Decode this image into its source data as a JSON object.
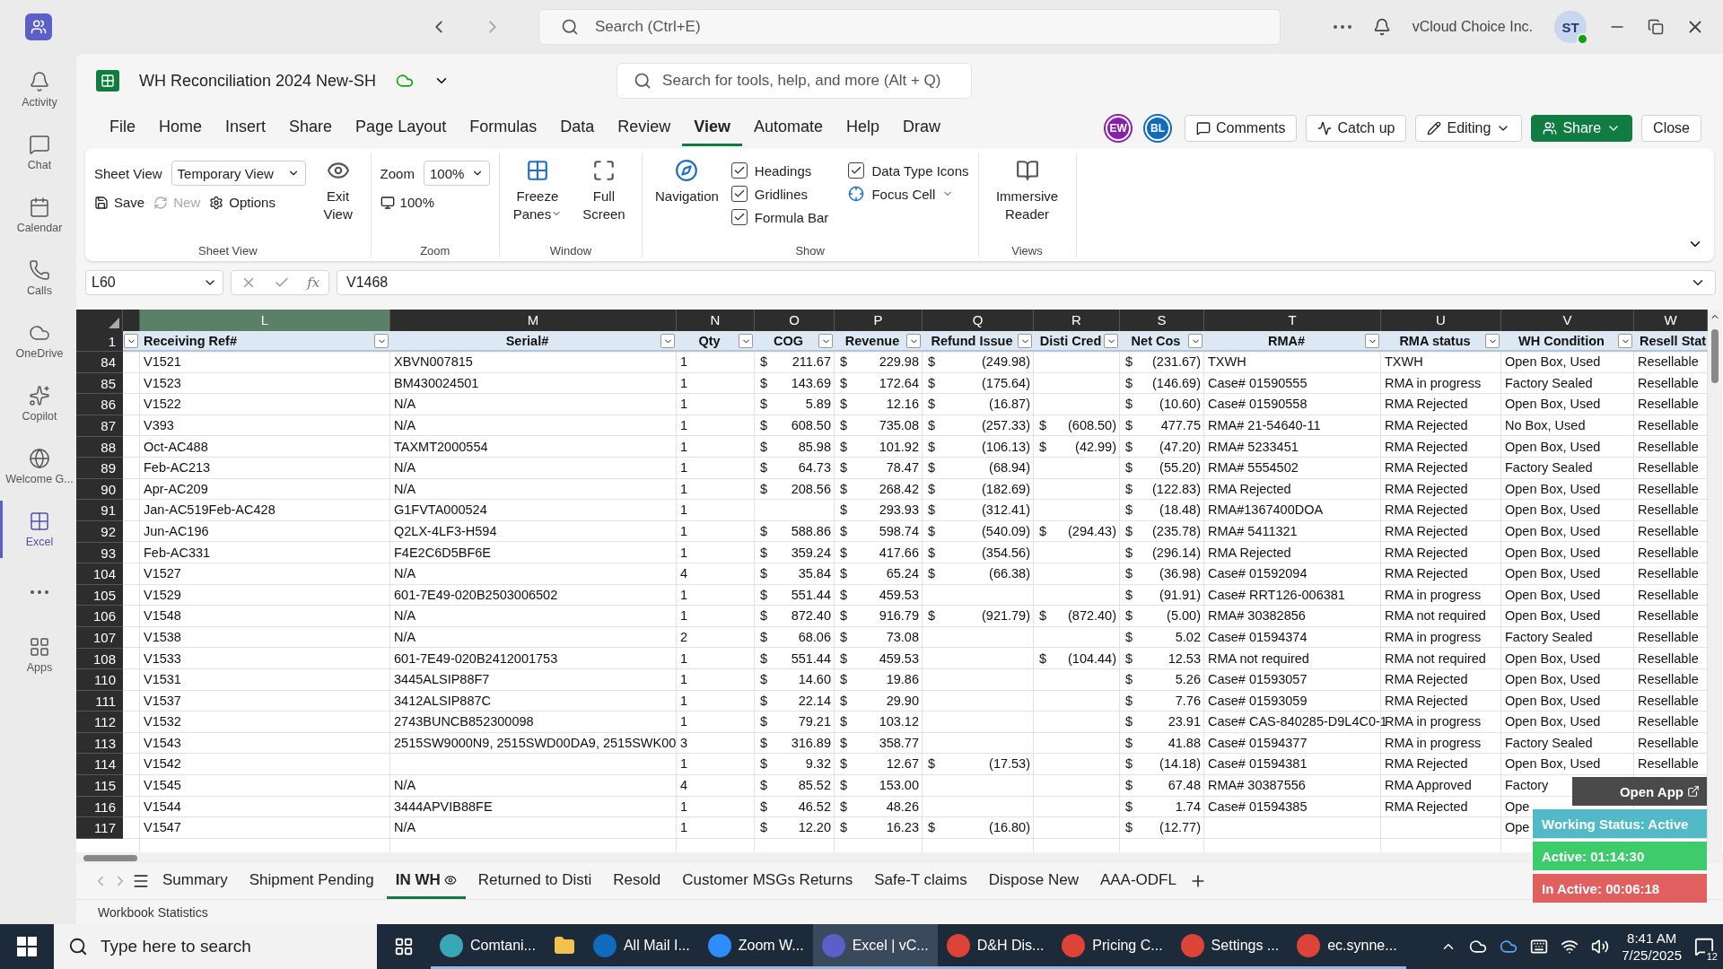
{
  "app_bar": {
    "search_placeholder": "Search (Ctrl+E)",
    "org": "vCloud Choice Inc.",
    "avatar": "ST"
  },
  "rail": [
    {
      "label": "Activity",
      "kind": "bell",
      "selected": false
    },
    {
      "label": "Chat",
      "kind": "chat",
      "selected": false
    },
    {
      "label": "Calendar",
      "kind": "calendar",
      "selected": false
    },
    {
      "label": "Calls",
      "kind": "calls",
      "selected": false
    },
    {
      "label": "OneDrive",
      "kind": "cloud",
      "selected": false
    },
    {
      "label": "Copilot",
      "kind": "copilot",
      "selected": false
    },
    {
      "label": "Welcome G...",
      "kind": "welcome",
      "selected": false
    },
    {
      "label": "Excel",
      "kind": "excel",
      "selected": true
    },
    {
      "kind": "more",
      "selected": false
    },
    {
      "label": "Apps",
      "kind": "apps",
      "selected": false
    }
  ],
  "workbook": {
    "title": "WH Reconciliation 2024 New-SH",
    "search_placeholder": "Search for tools, help, and more (Alt + Q)"
  },
  "menu": [
    {
      "label": "File",
      "selected": false
    },
    {
      "label": "Home",
      "selected": false
    },
    {
      "label": "Insert",
      "selected": false
    },
    {
      "label": "Share",
      "selected": false
    },
    {
      "label": "Page Layout",
      "selected": false
    },
    {
      "label": "Formulas",
      "selected": false
    },
    {
      "label": "Data",
      "selected": false
    },
    {
      "label": "Review",
      "selected": false
    },
    {
      "label": "View",
      "selected": true
    },
    {
      "label": "Automate",
      "selected": false
    },
    {
      "label": "Help",
      "selected": false
    },
    {
      "label": "Draw",
      "selected": false
    }
  ],
  "collaborators": [
    {
      "initials": "EW",
      "color": "#8a1fa8"
    },
    {
      "initials": "BL",
      "color": "#0f6cbd"
    }
  ],
  "actions": [
    {
      "label": "Comments",
      "kind": "comments"
    },
    {
      "label": "Catch up",
      "kind": "catchup"
    },
    {
      "label": "Editing",
      "kind": "editing"
    },
    {
      "label": "Share",
      "kind": "share"
    },
    {
      "label": "Close",
      "kind": "close"
    }
  ],
  "ribbon": {
    "sheet_view": {
      "title": "Sheet View",
      "field_label": "Sheet View",
      "value": "Temporary View",
      "buttons": [
        {
          "label": "Save",
          "kind": "save",
          "disabled": false
        },
        {
          "label": "New",
          "kind": "new",
          "disabled": true
        },
        {
          "label": "Options",
          "kind": "options",
          "disabled": false
        }
      ],
      "exit": "Exit View"
    },
    "zoom": {
      "title": "Zoom",
      "field_label": "Zoom",
      "value": "100%",
      "button": "100%"
    },
    "window": {
      "title": "Window",
      "buttons": [
        {
          "label": "Freeze Panes",
          "kind": "freeze"
        },
        {
          "label": "Full Screen",
          "kind": "fullscreen"
        }
      ]
    },
    "show": {
      "title": "Show",
      "navigation": "Navigation",
      "checkboxes": [
        {
          "label": "Headings",
          "checked": true
        },
        {
          "label": "Gridlines",
          "checked": true
        },
        {
          "label": "Formula Bar",
          "checked": true
        },
        {
          "label": "Data Type Icons",
          "checked": true
        }
      ],
      "focus_cell": "Focus Cell"
    },
    "views": {
      "title": "Views",
      "button": "Immersive Reader"
    }
  },
  "formula_bar": {
    "name_box": "L60",
    "function_label": "fx",
    "value": "V1468"
  },
  "table": {
    "columns": [
      {
        "letter": "L",
        "label": "Receiving Ref#",
        "selected": true
      },
      {
        "letter": "M",
        "label": "Serial#",
        "selected": false
      },
      {
        "letter": "N",
        "label": "Qty",
        "selected": false
      },
      {
        "letter": "O",
        "label": "COG",
        "selected": false
      },
      {
        "letter": "P",
        "label": "Revenue",
        "selected": false
      },
      {
        "letter": "Q",
        "label": "Refund Issue",
        "selected": false
      },
      {
        "letter": "R",
        "label": "Disti Cred",
        "selected": false
      },
      {
        "letter": "S",
        "label": "Net Cos",
        "selected": false
      },
      {
        "letter": "T",
        "label": "RMA#",
        "selected": false
      },
      {
        "letter": "U",
        "label": "RMA status",
        "selected": false
      },
      {
        "letter": "V",
        "label": "WH Condition",
        "selected": false
      },
      {
        "letter": "W",
        "label": "Resell Stat",
        "selected": false
      }
    ],
    "header_row": "1",
    "rows": [
      {
        "row": "84",
        "ref": "V1521",
        "serial": "XBVN007815",
        "qty": "1",
        "cog": [
          "$",
          "211.67"
        ],
        "revenue": [
          "$",
          "229.98"
        ],
        "refund": [
          "$",
          "(249.98)"
        ],
        "net": [
          "$",
          "(231.67)"
        ],
        "rma": "TXWH",
        "rma_status": "TXWH",
        "condition": "Open Box, Used",
        "resell": "Resellable"
      },
      {
        "row": "85",
        "ref": "V1523",
        "serial": "BM430024501",
        "qty": "1",
        "cog": [
          "$",
          "143.69"
        ],
        "revenue": [
          "$",
          "172.64"
        ],
        "refund": [
          "$",
          "(175.64)"
        ],
        "net": [
          "$",
          "(146.69)"
        ],
        "rma": "Case# 01590555",
        "rma_status": "RMA in progress",
        "condition": "Factory Sealed",
        "resell": "Resellable"
      },
      {
        "row": "86",
        "ref": "V1522",
        "serial": "N/A",
        "qty": "1",
        "cog": [
          "$",
          "5.89"
        ],
        "revenue": [
          "$",
          "12.16"
        ],
        "refund": [
          "$",
          "(16.87)"
        ],
        "net": [
          "$",
          "(10.60)"
        ],
        "rma": "Case# 01590558",
        "rma_status": "RMA Rejected",
        "condition": "Open Box, Used",
        "resell": "Resellable"
      },
      {
        "row": "87",
        "ref": "V393",
        "serial": "N/A",
        "qty": "1",
        "cog": [
          "$",
          "608.50"
        ],
        "revenue": [
          "$",
          "735.08"
        ],
        "refund": [
          "$",
          "(257.33)"
        ],
        "disti": [
          "$",
          "(608.50)"
        ],
        "net": [
          "$",
          "477.75"
        ],
        "rma": "RMA# 21-54640-11",
        "rma_status": "RMA Rejected",
        "condition": "No Box, Used",
        "resell": "Resellable"
      },
      {
        "row": "88",
        "ref": "Oct-AC488",
        "serial": "TAXMT2000554",
        "qty": "1",
        "cog": [
          "$",
          "85.98"
        ],
        "revenue": [
          "$",
          "101.92"
        ],
        "refund": [
          "$",
          "(106.13)"
        ],
        "disti": [
          "$",
          "(42.99)"
        ],
        "net": [
          "$",
          "(47.20)"
        ],
        "rma": "RMA# 5233451",
        "rma_status": "RMA Rejected",
        "condition": "Open Box, Used",
        "resell": "Resellable"
      },
      {
        "row": "89",
        "ref": "Feb-AC213",
        "serial": "N/A",
        "qty": "1",
        "cog": [
          "$",
          "64.73"
        ],
        "revenue": [
          "$",
          "78.47"
        ],
        "refund": [
          "$",
          "(68.94)"
        ],
        "net": [
          "$",
          "(55.20)"
        ],
        "rma": "RMA# 5554502",
        "rma_status": "RMA Rejected",
        "condition": "Factory Sealed",
        "resell": "Resellable"
      },
      {
        "row": "90",
        "ref": "Apr-AC209",
        "serial": "N/A",
        "qty": "1",
        "cog": [
          "$",
          "208.56"
        ],
        "revenue": [
          "$",
          "268.42"
        ],
        "refund": [
          "$",
          "(182.69)"
        ],
        "net": [
          "$",
          "(122.83)"
        ],
        "rma": "RMA Rejected",
        "rma_status": "RMA Rejected",
        "condition": "Open Box, Used",
        "resell": "Resellable"
      },
      {
        "row": "91",
        "ref": "Jan-AC519Feb-AC428",
        "serial": "G1FVTA000524",
        "qty": "1",
        "revenue": [
          "$",
          "293.93"
        ],
        "refund": [
          "$",
          "(312.41)"
        ],
        "net": [
          "$",
          "(18.48)"
        ],
        "rma": "RMA#1367400DOA",
        "rma_status": "RMA Rejected",
        "condition": "Open Box, Used",
        "resell": "Resellable"
      },
      {
        "row": "92",
        "ref": "Jun-AC196",
        "serial": "Q2LX-4LF3-H594",
        "qty": "1",
        "cog": [
          "$",
          "588.86"
        ],
        "revenue": [
          "$",
          "598.74"
        ],
        "refund": [
          "$",
          "(540.09)"
        ],
        "disti": [
          "$",
          "(294.43)"
        ],
        "net": [
          "$",
          "(235.78)"
        ],
        "rma": "RMA# 5411321",
        "rma_status": "RMA Rejected",
        "condition": "Open Box, Used",
        "resell": "Resellable"
      },
      {
        "row": "93",
        "ref": "Feb-AC331",
        "serial": "F4E2C6D5BF6E",
        "qty": "1",
        "cog": [
          "$",
          "359.24"
        ],
        "revenue": [
          "$",
          "417.66"
        ],
        "refund": [
          "$",
          "(354.56)"
        ],
        "net": [
          "$",
          "(296.14)"
        ],
        "rma": "RMA Rejected",
        "rma_status": "RMA Rejected",
        "condition": "Open Box, Used",
        "resell": "Resellable"
      },
      {
        "row": "104",
        "ref": "V1527",
        "serial": "N/A",
        "qty": "4",
        "cog": [
          "$",
          "35.84"
        ],
        "revenue": [
          "$",
          "65.24"
        ],
        "refund": [
          "$",
          "(66.38)"
        ],
        "net": [
          "$",
          "(36.98)"
        ],
        "rma": "Case# 01592094",
        "rma_status": "RMA Rejected",
        "condition": "Open Box, Used",
        "resell": "Resellable"
      },
      {
        "row": "105",
        "ref": "V1529",
        "serial": "601-7E49-020B2503006502",
        "qty": "1",
        "cog": [
          "$",
          "551.44"
        ],
        "revenue": [
          "$",
          "459.53"
        ],
        "net": [
          "$",
          "(91.91)"
        ],
        "rma": "Case# RRT126-006381",
        "rma_status": "RMA in progress",
        "condition": "Open Box, Used",
        "resell": "Resellable"
      },
      {
        "row": "106",
        "ref": "V1548",
        "serial": "N/A",
        "qty": "1",
        "cog": [
          "$",
          "872.40"
        ],
        "revenue": [
          "$",
          "916.79"
        ],
        "refund": [
          "$",
          "(921.79)"
        ],
        "disti": [
          "$",
          "(872.40)"
        ],
        "net": [
          "$",
          "(5.00)"
        ],
        "rma": "RMA# 30382856",
        "rma_status": "RMA not required",
        "condition": "Open Box, Used",
        "resell": "Resellable"
      },
      {
        "row": "107",
        "ref": "V1538",
        "serial": "N/A",
        "qty": "2",
        "cog": [
          "$",
          "68.06"
        ],
        "revenue": [
          "$",
          "73.08"
        ],
        "net": [
          "$",
          "5.02"
        ],
        "rma": "Case# 01594374",
        "rma_status": "RMA in progress",
        "condition": "Factory Sealed",
        "resell": "Resellable"
      },
      {
        "row": "108",
        "ref": "V1533",
        "serial": "601-7E49-020B2412001753",
        "qty": "1",
        "cog": [
          "$",
          "551.44"
        ],
        "revenue": [
          "$",
          "459.53"
        ],
        "disti": [
          "$",
          "(104.44)"
        ],
        "net": [
          "$",
          "12.53"
        ],
        "rma": "RMA not required",
        "rma_status": "RMA not required",
        "condition": "Open Box, Used",
        "resell": "Resellable"
      },
      {
        "row": "110",
        "ref": "V1531",
        "serial": "3445ALSIP88F7",
        "qty": "1",
        "cog": [
          "$",
          "14.60"
        ],
        "revenue": [
          "$",
          "19.86"
        ],
        "net": [
          "$",
          "5.26"
        ],
        "rma": "Case# 01593057",
        "rma_status": "RMA Rejected",
        "condition": "Open Box, Used",
        "resell": "Resellable"
      },
      {
        "row": "111",
        "ref": "V1537",
        "serial": "3412ALSIP887C",
        "qty": "1",
        "cog": [
          "$",
          "22.14"
        ],
        "revenue": [
          "$",
          "29.90"
        ],
        "net": [
          "$",
          "7.76"
        ],
        "rma": "Case# 01593059",
        "rma_status": "RMA Rejected",
        "condition": "Open Box, Used",
        "resell": "Resellable"
      },
      {
        "row": "112",
        "ref": "V1532",
        "serial": "2743BUNCB852300098",
        "qty": "1",
        "cog": [
          "$",
          "79.21"
        ],
        "revenue": [
          "$",
          "103.12"
        ],
        "net": [
          "$",
          "23.91"
        ],
        "rma": "Case# CAS-840285-D9L4C0-1",
        "rma_status": "RMA in progress",
        "condition": "Open Box, Used",
        "resell": "Resellable"
      },
      {
        "row": "113",
        "ref": "V1543",
        "serial": "2515SW9000N9, 2515SWD00DA9, 2515SWK00",
        "qty": "3",
        "cog": [
          "$",
          "316.89"
        ],
        "revenue": [
          "$",
          "358.77"
        ],
        "net": [
          "$",
          "41.88"
        ],
        "rma": "Case# 01594377",
        "rma_status": "RMA in progress",
        "condition": "Factory Sealed",
        "resell": "Resellable"
      },
      {
        "row": "114",
        "ref": "V1542",
        "qty": "1",
        "cog": [
          "$",
          "9.32"
        ],
        "revenue": [
          "$",
          "12.67"
        ],
        "refund": [
          "$",
          "(17.53)"
        ],
        "net": [
          "$",
          "(14.18)"
        ],
        "rma": "Case# 01594381",
        "rma_status": "RMA Rejected",
        "condition": "Open Box, Used",
        "resell": "Resellable"
      },
      {
        "row": "115",
        "ref": "V1545",
        "serial": "N/A",
        "qty": "4",
        "cog": [
          "$",
          "85.52"
        ],
        "revenue": [
          "$",
          "153.00"
        ],
        "net": [
          "$",
          "67.48"
        ],
        "rma": "RMA# 30387556",
        "rma_status": "RMA Approved",
        "condition": "Factory"
      },
      {
        "row": "116",
        "ref": "V1544",
        "serial": "3444APVIB88FE",
        "qty": "1",
        "cog": [
          "$",
          "46.52"
        ],
        "revenue": [
          "$",
          "48.26"
        ],
        "net": [
          "$",
          "1.74"
        ],
        "rma": "Case# 01594385",
        "rma_status": "RMA Rejected",
        "condition": "Ope"
      },
      {
        "row": "117",
        "ref": "V1547",
        "serial": "N/A",
        "qty": "1",
        "cog": [
          "$",
          "12.20"
        ],
        "revenue": [
          "$",
          "16.23"
        ],
        "refund": [
          "$",
          "(16.80)"
        ],
        "net": [
          "$",
          "(12.77)"
        ],
        "condition": "Ope"
      }
    ]
  },
  "sheet_tabs": [
    {
      "label": "Summary",
      "selected": false
    },
    {
      "label": "Shipment Pending",
      "selected": false
    },
    {
      "label": "IN WH",
      "selected": true
    },
    {
      "label": "Returned to Disti",
      "selected": false
    },
    {
      "label": "Resold",
      "selected": false
    },
    {
      "label": "Customer MSGs Returns",
      "selected": false
    },
    {
      "label": "Safe-T claims",
      "selected": false
    },
    {
      "label": "Dispose New",
      "selected": false
    },
    {
      "label": "AAA-ODFL",
      "selected": false
    }
  ],
  "status_bar": {
    "label": "Workbook Statistics"
  },
  "overlay": {
    "open_app": "Open App",
    "status": "Working Status: Active",
    "active": "Active: 01:14:30",
    "inactive": "In Active: 00:06:18"
  },
  "taskbar": {
    "search_placeholder": "Type here to search",
    "apps": [
      {
        "label": "Comtani...",
        "kind": "comtania",
        "selected": false
      },
      {
        "kind": "explorer",
        "selected": false
      },
      {
        "label": "All Mail I...",
        "kind": "outlook",
        "selected": false
      },
      {
        "label": "Zoom W...",
        "kind": "zoom",
        "selected": false
      },
      {
        "label": "Excel | vC...",
        "kind": "teams",
        "selected": true
      },
      {
        "label": "D&H Dis...",
        "kind": "chrome",
        "selected": false
      },
      {
        "label": "Pricing C...",
        "kind": "chrome",
        "selected": false
      },
      {
        "label": "Settings ...",
        "kind": "chrome",
        "selected": false
      },
      {
        "label": "ec.synne...",
        "kind": "chrome",
        "selected": false
      }
    ],
    "time": "8:41 AM",
    "date": "7/25/2025",
    "notifications": "12"
  }
}
